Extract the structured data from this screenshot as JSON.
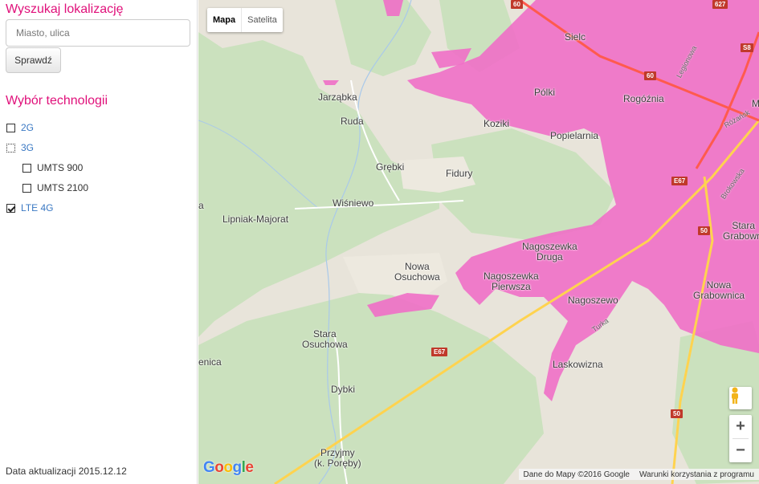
{
  "sidebar": {
    "search_heading": "Wyszukaj lokalizację",
    "search_placeholder": "Miasto, ulica",
    "check_button": "Sprawdź",
    "tech_heading": "Wybór technologii",
    "technologies": [
      {
        "label": "2G",
        "checked": false
      },
      {
        "label": "3G",
        "checked": false
      },
      {
        "label": "UMTS 900",
        "checked": false
      },
      {
        "label": "UMTS 2100",
        "checked": false
      },
      {
        "label": "LTE 4G",
        "checked": true
      }
    ],
    "updated": "Data aktualizacji 2015.12.12"
  },
  "map": {
    "map_type": {
      "map": "Mapa",
      "satellite": "Satelita"
    },
    "places": [
      "Sielc",
      "Pólki",
      "Rogóźnia",
      "Jarząbka",
      "Ruda",
      "Koziki",
      "Popielarnia",
      "Grębki",
      "Fidury",
      "Wiśniewo",
      "Lipniak-Majorat",
      "Nagoszewka\nDruga",
      "Nowa\nOsuchowa",
      "Nagoszewka\nPierwsza",
      "Nowa\nGrabownica",
      "Nagoszewo",
      "Stara\nOsuchowa",
      "Laskowizna",
      "Dybki",
      "Przyjmy\n(k. Poręby)",
      "Stara\nGrabowni",
      "enica",
      "M",
      "a"
    ],
    "road_shields": [
      "60",
      "60",
      "S8",
      "E67",
      "50",
      "E67",
      "50",
      "627"
    ],
    "road_labels": [
      "Legionowa",
      "Różańsk",
      "Brokowska",
      "Turka"
    ],
    "attribution": "Dane do Mapy ©2016 Google",
    "terms": "Warunki korzystania z programu",
    "google_logo": "Google",
    "zoom_in": "+",
    "zoom_out": "−",
    "colors": {
      "coverage": "#f06fc7",
      "land": "#e8e4da",
      "forest": "#cbe1be",
      "highway": "#ff5a4e",
      "road": "#ffd34f",
      "accent": "#e0107a"
    }
  }
}
